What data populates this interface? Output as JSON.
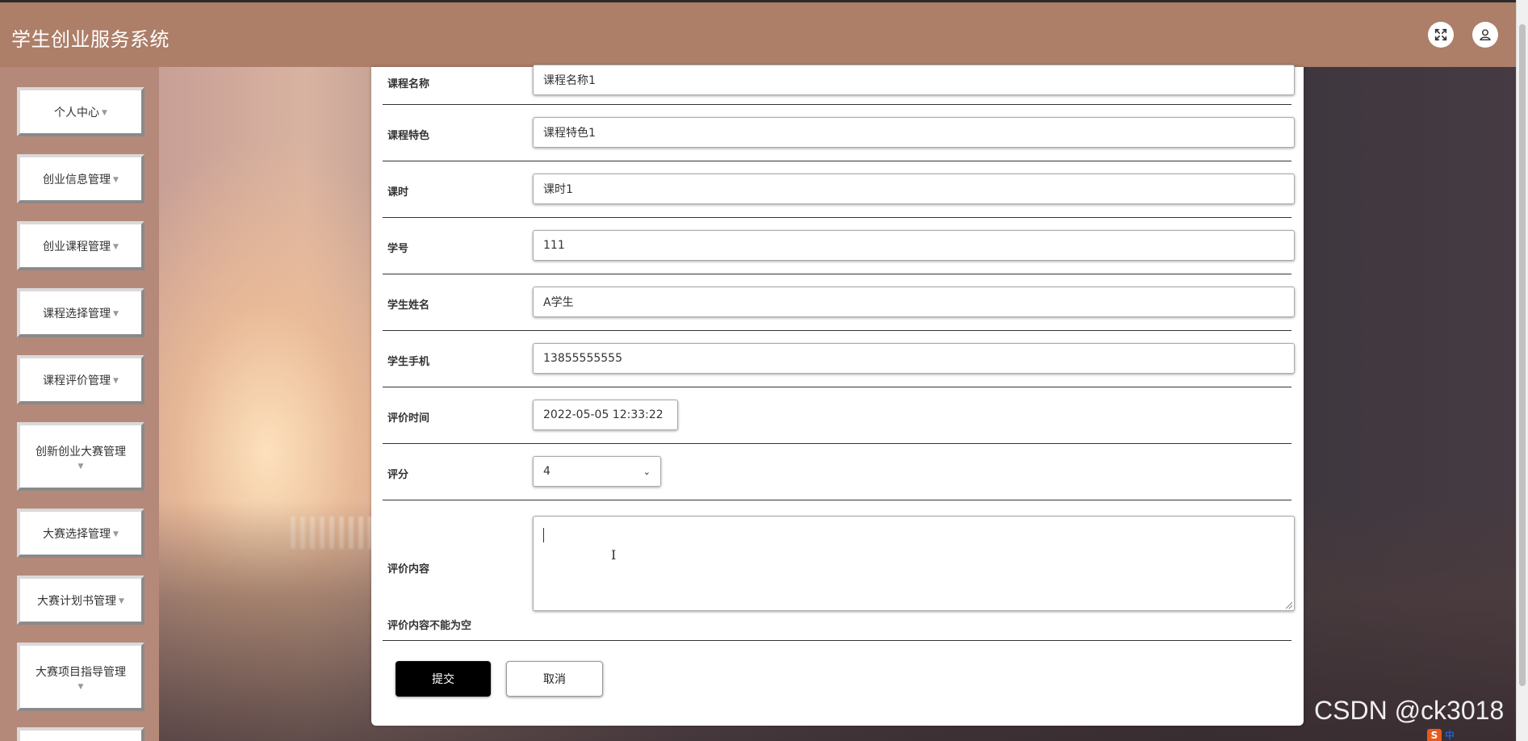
{
  "app": {
    "title": "学生创业服务系统"
  },
  "header": {
    "fullscreen_icon": "expand-icon",
    "user_icon": "user-icon"
  },
  "sidebar": {
    "items": [
      {
        "label": "个人中心"
      },
      {
        "label": "创业信息管理"
      },
      {
        "label": "创业课程管理"
      },
      {
        "label": "课程选择管理"
      },
      {
        "label": "课程评价管理"
      },
      {
        "label": "创新创业大赛管理"
      },
      {
        "label": "大赛选择管理"
      },
      {
        "label": "大赛计划书管理"
      },
      {
        "label": "大赛项目指导管理"
      }
    ]
  },
  "form": {
    "fields": [
      {
        "label": "课程名称",
        "value": "课程名称1"
      },
      {
        "label": "课程特色",
        "value": "课程特色1"
      },
      {
        "label": "课时",
        "value": "课时1"
      },
      {
        "label": "学号",
        "value": "111"
      },
      {
        "label": "学生姓名",
        "value": "A学生"
      },
      {
        "label": "学生手机",
        "value": "13855555555"
      },
      {
        "label": "评价时间",
        "value": "2022-05-05 12:33:22"
      }
    ],
    "rating": {
      "label": "评分",
      "selected": "4"
    },
    "content": {
      "label": "评价内容",
      "value": "",
      "error": "评价内容不能为空"
    },
    "submit_label": "提交",
    "cancel_label": "取消"
  },
  "watermark": "CSDN @ck3018",
  "ime": {
    "logo": "S",
    "mode": "中"
  }
}
